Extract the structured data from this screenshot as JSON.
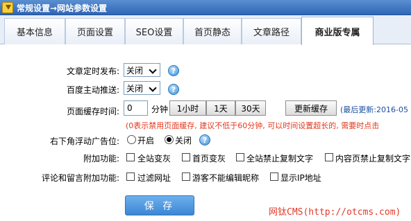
{
  "titlebar": {
    "title": "常规设置→网站参数设置"
  },
  "tabs": [
    "基本信息",
    "页面设置",
    "SEO设置",
    "首页静态",
    "文章路径",
    "商业版专属"
  ],
  "form": {
    "timed_publish": {
      "label": "文章定时发布:",
      "value": "关闭"
    },
    "baidu_push": {
      "label": "百度主动推送:",
      "value": "关闭"
    },
    "cache": {
      "label": "页面缓存时间:",
      "value": "0",
      "unit": "分钟",
      "presets": [
        "1小时",
        "1天",
        "30天"
      ],
      "update_button": "更新缓存",
      "last_update": "(最后更新:2016-05",
      "hint": "(0表示禁用页面缓存, 建议不低于60分钟, 可以时间设置超长的, 需要时点击"
    },
    "float_ad": {
      "label": "右下角浮动广告位:",
      "options": [
        "开启",
        "关闭"
      ],
      "selected": "关闭"
    },
    "addons": {
      "label": "附加功能:",
      "options": [
        "全站变灰",
        "首页变灰",
        "全站禁止复制文字",
        "内容页禁止复制文字"
      ]
    },
    "comment_addons": {
      "label": "评论和留言附加功能:",
      "options": [
        "过滤网址",
        "游客不能编辑昵称",
        "显示IP地址"
      ]
    }
  },
  "save_button": "保 存",
  "watermark": "网钛CMS(http://otcms.com)",
  "colors": {
    "accent": "#3b86d4",
    "hint": "#e3371e",
    "titlebar": "#2e66b6"
  }
}
